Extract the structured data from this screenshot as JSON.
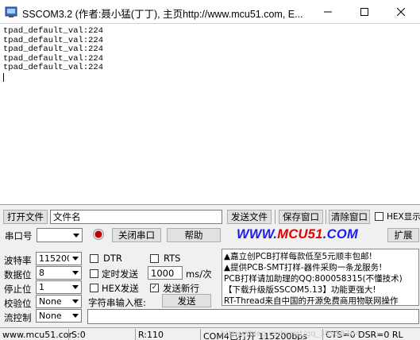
{
  "window": {
    "title": "SSCOM3.2 (作者:聂小猛(丁丁), 主页http://www.mcu51.com,  E..."
  },
  "receive": {
    "lines": [
      "tpad_default_val:224",
      "tpad_default_val:224",
      "tpad_default_val:224",
      "tpad_default_val:224",
      "tpad_default_val:224"
    ]
  },
  "toolbar1": {
    "open_file": "打开文件",
    "filename_value": "文件名",
    "send_file": "发送文件",
    "save_window": "保存窗口",
    "clear_window": "清除窗口",
    "hex_display": "HEX显示"
  },
  "toolbar2": {
    "port_label": "串口号",
    "port_value": "",
    "close_port": "关闭串口",
    "help": "帮助",
    "link": "WWW.MCU51.COM",
    "expand": "扩展"
  },
  "settings": {
    "baud_label": "波特率",
    "baud_value": "115200",
    "databits_label": "数据位",
    "databits_value": "8",
    "stopbits_label": "停止位",
    "stopbits_value": "1",
    "parity_label": "校验位",
    "parity_value": "None",
    "flow_label": "流控制",
    "flow_value": "None"
  },
  "send": {
    "dtr": "DTR",
    "rts": "RTS",
    "timed_send": "定时发送",
    "interval_value": "1000",
    "interval_unit": "ms/次",
    "hex_send": "HEX发送",
    "send_newline": "发送新行",
    "input_label": "字符串输入框:",
    "send_button": "发送",
    "input_value": ""
  },
  "info_lines": [
    "▲嘉立创PCB打样每款低至5元顺丰包邮!",
    "▲提供PCB-SMT打样-器件采购一条龙服务!",
    "PCB打样请加助理的QQ:800058315(不懂技术)",
    "【下载升级版SSCOM5.13】功能更强大!",
    "RT-Thread来自中国的开源免费商用物联网操作"
  ],
  "status": {
    "site": "www.mcu51.cor",
    "sent": "S:0",
    "received": "R:110",
    "port_state": "COM4已打开  115200bps",
    "signals": "CTS=0 DSR=0 RL",
    "watermark": "https://blog.csdn.net/qq_38958704"
  },
  "colors": {
    "link": "#1c1cf0",
    "record_icon": "#c00000"
  }
}
